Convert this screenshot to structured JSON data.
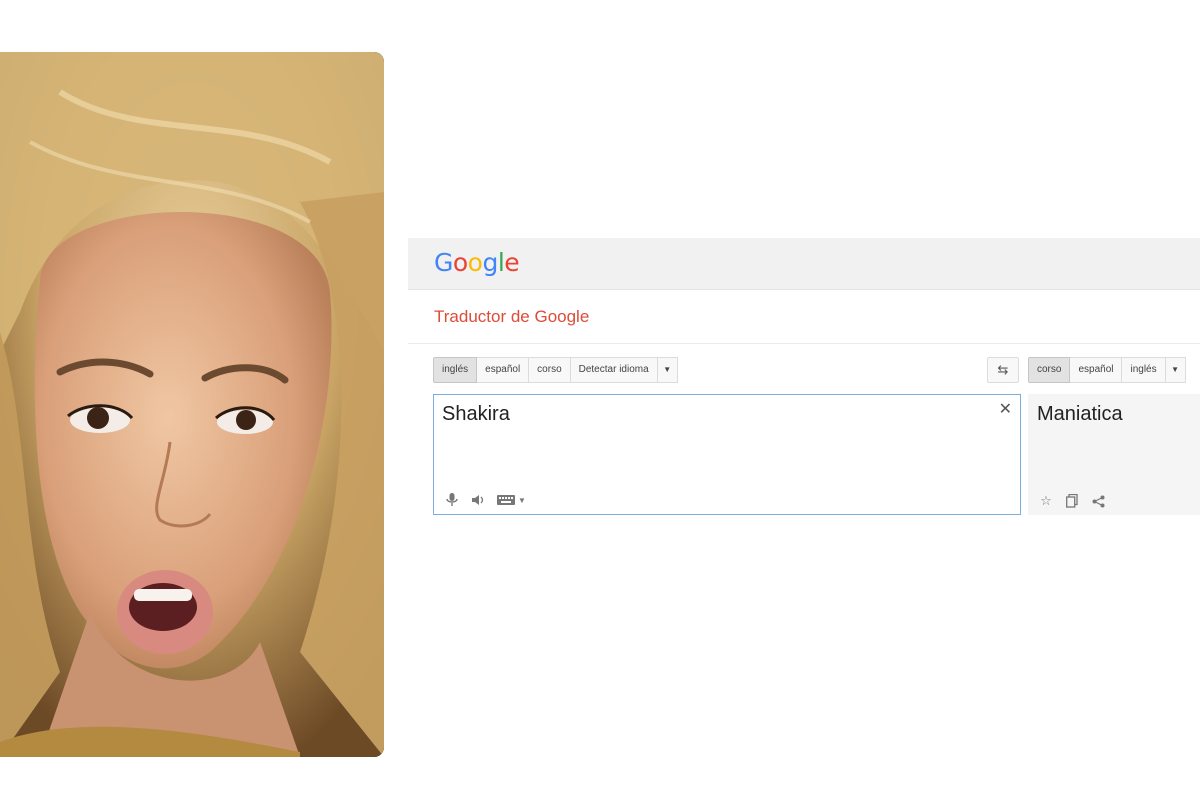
{
  "header": {
    "logo_letters": [
      "G",
      "o",
      "o",
      "g",
      "l",
      "e"
    ]
  },
  "app_title": "Traductor de Google",
  "source": {
    "languages": [
      "inglés",
      "español",
      "corso",
      "Detectar idioma"
    ],
    "active_language": "inglés",
    "text": "Shakira",
    "icons": [
      "mic-icon",
      "speaker-icon",
      "keyboard-icon",
      "dropdown-arrow-icon"
    ]
  },
  "target": {
    "languages": [
      "corso",
      "español",
      "inglés"
    ],
    "active_language": "corso",
    "text": "Maniatica",
    "icons": [
      "star-icon",
      "copy-icon",
      "share-icon"
    ]
  },
  "colors": {
    "app_title": "#dd4b39",
    "source_border": "#7baedc"
  },
  "photo": {
    "icon": "portrait-photo"
  }
}
